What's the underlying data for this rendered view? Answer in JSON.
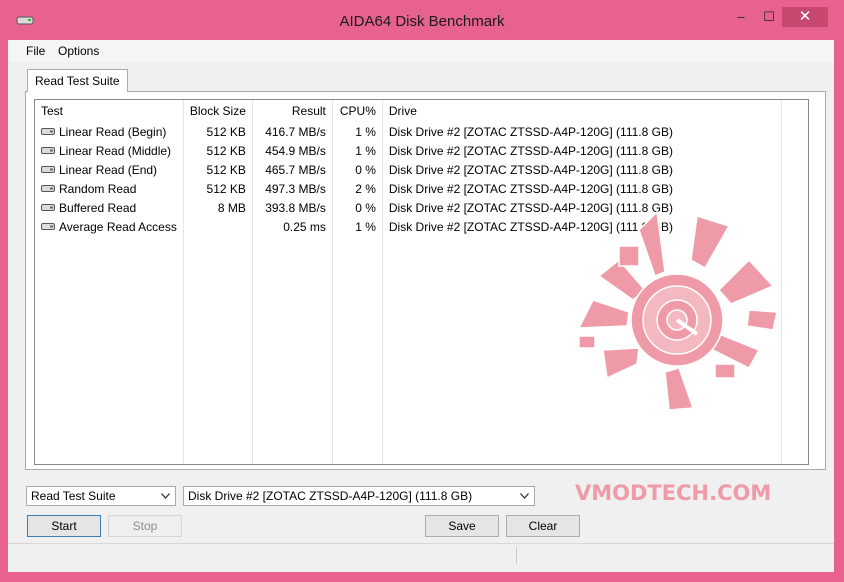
{
  "window": {
    "title": "AIDA64 Disk Benchmark",
    "minimize": "‒",
    "maximize": "☐",
    "close": "✕",
    "app_icon": "disk-icon"
  },
  "menu": {
    "items": [
      "File",
      "Options"
    ]
  },
  "tab": {
    "label": "Read Test Suite"
  },
  "columns": [
    "Test",
    "Block Size",
    "Result",
    "CPU%",
    "Drive"
  ],
  "rows": [
    {
      "test": "Linear Read (Begin)",
      "block": "512 KB",
      "result": "416.7 MB/s",
      "cpu": "1 %",
      "drive": "Disk Drive #2  [ZOTAC ZTSSD-A4P-120G]  (111.8 GB)"
    },
    {
      "test": "Linear Read (Middle)",
      "block": "512 KB",
      "result": "454.9 MB/s",
      "cpu": "1 %",
      "drive": "Disk Drive #2  [ZOTAC ZTSSD-A4P-120G]  (111.8 GB)"
    },
    {
      "test": "Linear Read (End)",
      "block": "512 KB",
      "result": "465.7 MB/s",
      "cpu": "0 %",
      "drive": "Disk Drive #2  [ZOTAC ZTSSD-A4P-120G]  (111.8 GB)"
    },
    {
      "test": "Random Read",
      "block": "512 KB",
      "result": "497.3 MB/s",
      "cpu": "2 %",
      "drive": "Disk Drive #2  [ZOTAC ZTSSD-A4P-120G]  (111.8 GB)"
    },
    {
      "test": "Buffered Read",
      "block": "8 MB",
      "result": "393.8 MB/s",
      "cpu": "0 %",
      "drive": "Disk Drive #2  [ZOTAC ZTSSD-A4P-120G]  (111.8 GB)"
    },
    {
      "test": "Average Read Access",
      "block": "",
      "result": "0.25 ms",
      "cpu": "1 %",
      "drive": "Disk Drive #2  [ZOTAC ZTSSD-A4P-120G]  (111.8 GB)"
    }
  ],
  "controls": {
    "suite_select": "Read Test Suite",
    "drive_select": "Disk Drive #2  [ZOTAC ZTSSD-A4P-120G]  (111.8 GB)",
    "start": "Start",
    "stop": "Stop",
    "save": "Save",
    "clear": "Clear"
  },
  "watermark": {
    "text": "VMODTECH.COM"
  },
  "colors": {
    "frame": "#e7628f",
    "watermark": "#ef9aa7"
  }
}
